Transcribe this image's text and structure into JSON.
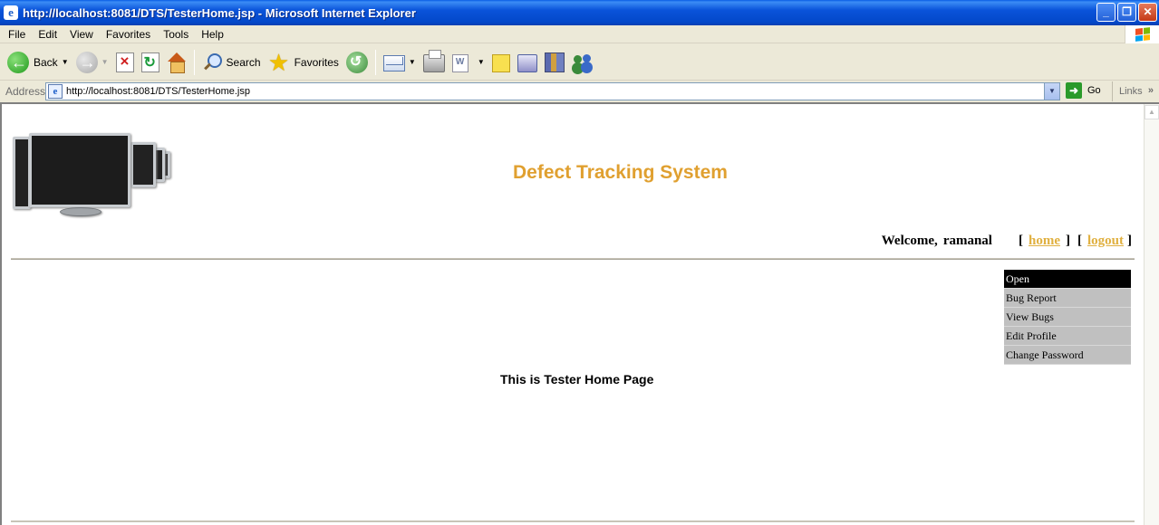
{
  "window": {
    "title": "http://localhost:8081/DTS/TesterHome.jsp - Microsoft Internet Explorer"
  },
  "menubar": {
    "items": [
      "File",
      "Edit",
      "View",
      "Favorites",
      "Tools",
      "Help"
    ]
  },
  "toolbar": {
    "back_label": "Back",
    "search_label": "Search",
    "favorites_label": "Favorites"
  },
  "address": {
    "label": "Address",
    "url": "http://localhost:8081/DTS/TesterHome.jsp",
    "go_label": "Go",
    "links_label": "Links"
  },
  "page": {
    "site_title": "Defect Tracking System",
    "welcome_label": "Welcome,",
    "username": "ramanal",
    "nav": {
      "home": "home",
      "logout": "logout"
    },
    "menu": [
      "Open",
      "Bug Report",
      "View Bugs",
      "Edit Profile",
      "Change Password"
    ],
    "main_text": "This is Tester Home Page"
  },
  "colors": {
    "title_accent": "#e0a030",
    "menu_bg": "#c0c0c0",
    "menu_active_bg": "#000000"
  }
}
